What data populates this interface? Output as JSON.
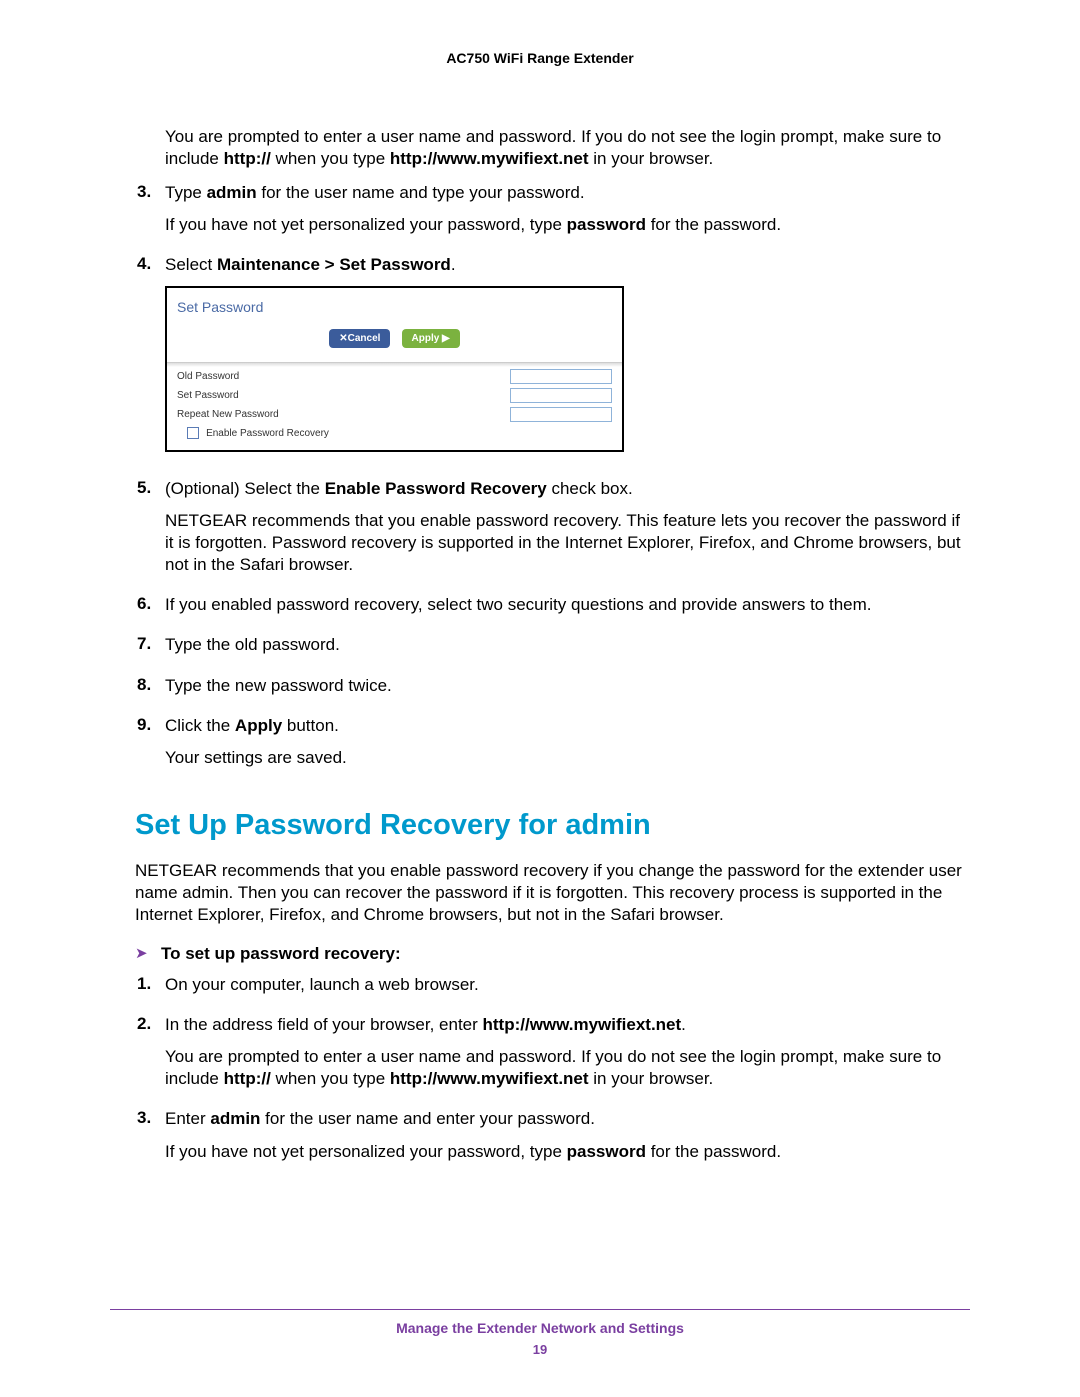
{
  "header": {
    "title": "AC750 WiFi Range Extender"
  },
  "intro": {
    "prompt_a": "You are prompted to enter a user name and password. If you do not see the login prompt, make sure to include ",
    "http": "http://",
    "prompt_b": " when you type ",
    "url": "http://www.mywifiext.net",
    "prompt_c": " in your browser."
  },
  "step3": {
    "num": "3.",
    "a": "Type ",
    "admin": "admin",
    "b": " for the user name and type your password.",
    "note_a": "If you have not yet personalized your password, type ",
    "pw": "password",
    "note_b": " for the password."
  },
  "step4": {
    "num": "4.",
    "a": "Select ",
    "path": "Maintenance > Set Password",
    "dot": "."
  },
  "screenshot": {
    "title": "Set Password",
    "cancel": "Cancel",
    "apply": "Apply ▶",
    "old": "Old Password",
    "set": "Set Password",
    "repeat": "Repeat New Password",
    "enable": "Enable Password Recovery"
  },
  "step5": {
    "num": "5.",
    "a": "(Optional) Select the ",
    "b": "Enable Password Recovery",
    "c": " check box.",
    "note": "NETGEAR recommends that you enable password recovery. This feature lets you recover the password if it is forgotten. Password recovery is supported in the Internet Explorer, Firefox, and Chrome browsers, but not in the Safari browser."
  },
  "step6": {
    "num": "6.",
    "text": "If you enabled password recovery, select two security questions and provide answers to them."
  },
  "step7": {
    "num": "7.",
    "text": "Type the old password."
  },
  "step8": {
    "num": "8.",
    "text": "Type the new password twice."
  },
  "step9": {
    "num": "9.",
    "a": "Click the ",
    "b": "Apply",
    "c": " button.",
    "note": "Your settings are saved."
  },
  "section2": {
    "heading": "Set Up Password Recovery for admin",
    "intro": "NETGEAR recommends that you enable password recovery if you change the password for the extender user name admin. Then you can recover the password if it is forgotten. This recovery process is supported in the Internet Explorer, Firefox, and Chrome browsers, but not in the Safari browser.",
    "proc": "To set up password recovery:"
  },
  "s2_step1": {
    "num": "1.",
    "text": "On your computer, launch a web browser."
  },
  "s2_step2": {
    "num": "2.",
    "a": "In the address field of your browser, enter ",
    "url": "http://www.mywifiext.net",
    "dot": ".",
    "note_a": "You are prompted to enter a user name and password. If you do not see the login prompt, make sure to include ",
    "http": "http://",
    "note_b": " when you type ",
    "note_c": " in your browser."
  },
  "s2_step3": {
    "num": "3.",
    "a": "Enter ",
    "admin": "admin",
    "b": " for the user name and enter your password.",
    "note_a": "If you have not yet personalized your password, type ",
    "pw": "password",
    "note_b": " for the password."
  },
  "footer": {
    "title": "Manage the Extender Network and Settings",
    "page": "19"
  }
}
